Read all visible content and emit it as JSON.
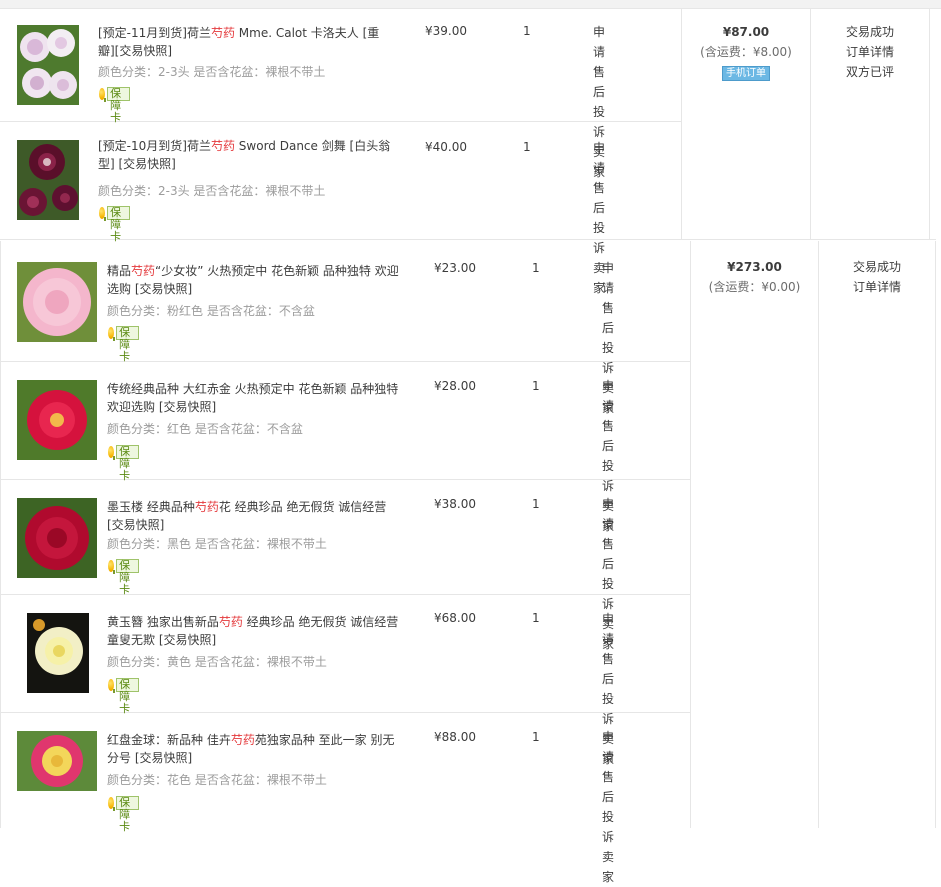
{
  "orders": [
    {
      "total_amount": "¥87.00",
      "shipping_note": "(含运费：¥8.00)",
      "mobile_badge": "手机订单",
      "status_items": [
        "交易成功",
        "订单详情",
        "双方已评"
      ],
      "items": [
        {
          "image_icon": "peony-white-pink-photo",
          "title_before": "[预定-11月到货]荷兰",
          "title_highlight": "芍药",
          "title_after": " Mme. Calot 卡洛夫人 [重瓣][交易快照]",
          "attrs": "颜色分类：2-3头   是否含花盆：裸根不带土",
          "guarantee": "保障卡",
          "price": "¥39.00",
          "qty": "1",
          "after_sale": [
            "申请售后",
            "投诉卖家"
          ]
        },
        {
          "image_icon": "peony-dark-red-photo",
          "title_before": "[预定-10月到货]荷兰",
          "title_highlight": "芍药",
          "title_after": " Sword Dance 剑舞 [白头翁型] [交易快照]",
          "attrs": "颜色分类：2-3头   是否含花盆：裸根不带土",
          "guarantee": "保障卡",
          "price": "¥40.00",
          "qty": "1",
          "after_sale": [
            "申请售后",
            "投诉卖家"
          ]
        }
      ]
    },
    {
      "total_amount": "¥273.00",
      "shipping_note": "(含运费：¥0.00)",
      "status_items": [
        "交易成功",
        "订单详情"
      ],
      "items": [
        {
          "image_icon": "peony-pink-photo",
          "title_before": "精品",
          "title_highlight": "芍药",
          "title_after": "“少女妆” 火热预定中 花色新颖 品种独特 欢迎选购 [交易快照]",
          "attrs": "颜色分类：粉红色   是否含花盆：不含盆",
          "guarantee": "保障卡",
          "price": "¥23.00",
          "qty": "1",
          "after_sale": [
            "申请售后",
            "投诉卖家"
          ]
        },
        {
          "image_icon": "peony-red-photo",
          "title_before": "传统经典品种 大红赤金 火热预定中 花色新颖 品种独特 欢迎选购 [交易快照]",
          "title_highlight": "",
          "title_after": "",
          "attrs": "颜色分类：红色   是否含花盆：不含盆",
          "guarantee": "保障卡",
          "price": "¥28.00",
          "qty": "1",
          "after_sale": [
            "申请售后",
            "投诉卖家"
          ]
        },
        {
          "image_icon": "peony-black-red-photo",
          "title_before": "墨玉楼 经典品种",
          "title_highlight": "芍药",
          "title_after": "花 经典珍品 绝无假货 诚信经营 [交易快照]",
          "attrs": "颜色分类：黑色   是否含花盆：裸根不带土",
          "guarantee": "保障卡",
          "price": "¥38.00",
          "qty": "1",
          "after_sale": [
            "申请售后",
            "投诉卖家"
          ]
        },
        {
          "image_icon": "peony-yellow-photo",
          "title_before": "黄玉簪 独家出售新品",
          "title_highlight": "芍药",
          "title_after": " 经典珍品 绝无假货 诚信经营 童叟无欺 [交易快照]",
          "attrs": "颜色分类：黄色   是否含花盆：裸根不带土",
          "guarantee": "保障卡",
          "price": "¥68.00",
          "qty": "1",
          "after_sale": [
            "申请售后",
            "投诉卖家"
          ]
        },
        {
          "image_icon": "peony-magenta-yellow-photo",
          "title_before": "红盘金球：新品种 佳卉",
          "title_highlight": "芍药",
          "title_after": "苑独家品种 至此一家 别无分号 [交易快照]",
          "attrs": "颜色分类：花色   是否含花盆：裸根不带土",
          "guarantee": "保障卡",
          "price": "¥88.00",
          "qty": "1",
          "after_sale": [
            "申请售后",
            "投诉卖家"
          ]
        }
      ]
    }
  ]
}
